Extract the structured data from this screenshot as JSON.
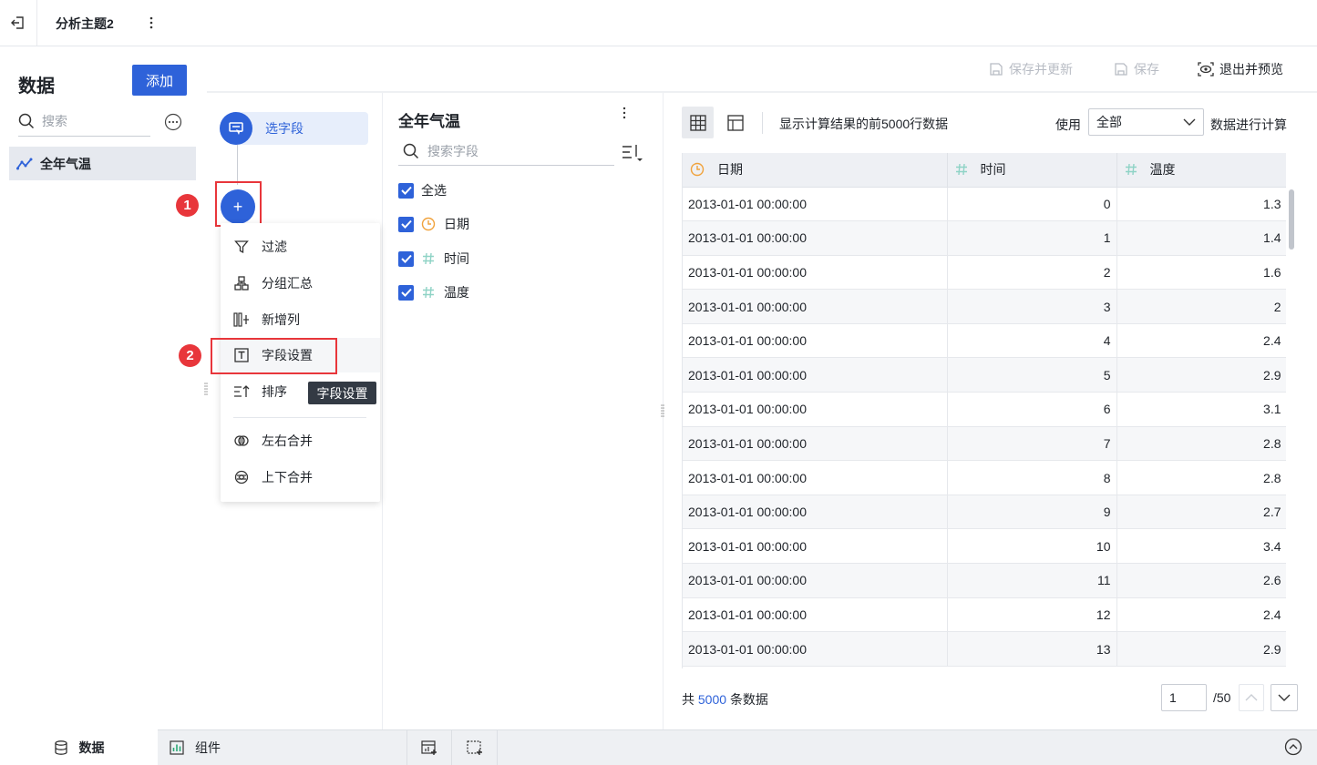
{
  "header": {
    "tab_title": "分析主题2"
  },
  "left_panel": {
    "heading": "数据",
    "add_label": "添加",
    "search_placeholder": "搜索",
    "datasets": [
      {
        "label": "全年气温",
        "icon": "line-chart-icon"
      }
    ]
  },
  "toolbar": {
    "save_update_label": "保存并更新",
    "save_label": "保存",
    "exit_preview_label": "退出并预览"
  },
  "flow": {
    "select_field_label": "选字段",
    "plus_label": "+",
    "badges": [
      "1",
      "2"
    ],
    "menu": [
      {
        "label": "过滤",
        "icon": "filter-icon"
      },
      {
        "label": "分组汇总",
        "icon": "group-summary-icon"
      },
      {
        "label": "新增列",
        "icon": "new-column-icon"
      },
      {
        "label": "字段设置",
        "icon": "field-settings-icon"
      },
      {
        "label": "排序",
        "icon": "sort-icon"
      },
      {
        "label": "左右合并",
        "icon": "merge-horizontal-icon"
      },
      {
        "label": "上下合并",
        "icon": "merge-vertical-icon"
      }
    ],
    "tooltip": "字段设置"
  },
  "fields": {
    "title": "全年气温",
    "search_placeholder": "搜索字段",
    "select_all": "全选",
    "items": [
      {
        "label": "日期",
        "type_icon": "clock-icon",
        "color": "#f0a23b"
      },
      {
        "label": "时间",
        "type_icon": "number-icon",
        "color": "#8fd3c6"
      },
      {
        "label": "温度",
        "type_icon": "number-icon",
        "color": "#8fd3c6"
      }
    ]
  },
  "preview": {
    "note": "显示计算结果的前5000行数据",
    "use_label": "使用",
    "scope_value": "全部",
    "calc_label": "数据进行计算",
    "columns": [
      "日期",
      "时间",
      "温度"
    ],
    "rows": [
      [
        "2013-01-01 00:00:00",
        "0",
        "1.3"
      ],
      [
        "2013-01-01 00:00:00",
        "1",
        "1.4"
      ],
      [
        "2013-01-01 00:00:00",
        "2",
        "1.6"
      ],
      [
        "2013-01-01 00:00:00",
        "3",
        "2"
      ],
      [
        "2013-01-01 00:00:00",
        "4",
        "2.4"
      ],
      [
        "2013-01-01 00:00:00",
        "5",
        "2.9"
      ],
      [
        "2013-01-01 00:00:00",
        "6",
        "3.1"
      ],
      [
        "2013-01-01 00:00:00",
        "7",
        "2.8"
      ],
      [
        "2013-01-01 00:00:00",
        "8",
        "2.8"
      ],
      [
        "2013-01-01 00:00:00",
        "9",
        "2.7"
      ],
      [
        "2013-01-01 00:00:00",
        "10",
        "3.4"
      ],
      [
        "2013-01-01 00:00:00",
        "11",
        "2.6"
      ],
      [
        "2013-01-01 00:00:00",
        "12",
        "2.4"
      ],
      [
        "2013-01-01 00:00:00",
        "13",
        "2.9"
      ]
    ],
    "total_prefix": "共",
    "total_count": "5000",
    "total_suffix": "条数据",
    "page_value": "1",
    "page_total": "/50"
  },
  "bottom": {
    "tab_data": "数据",
    "tab_components": "组件"
  },
  "colors": {
    "accent": "#2e62d9",
    "highlight": "#e8363b"
  }
}
